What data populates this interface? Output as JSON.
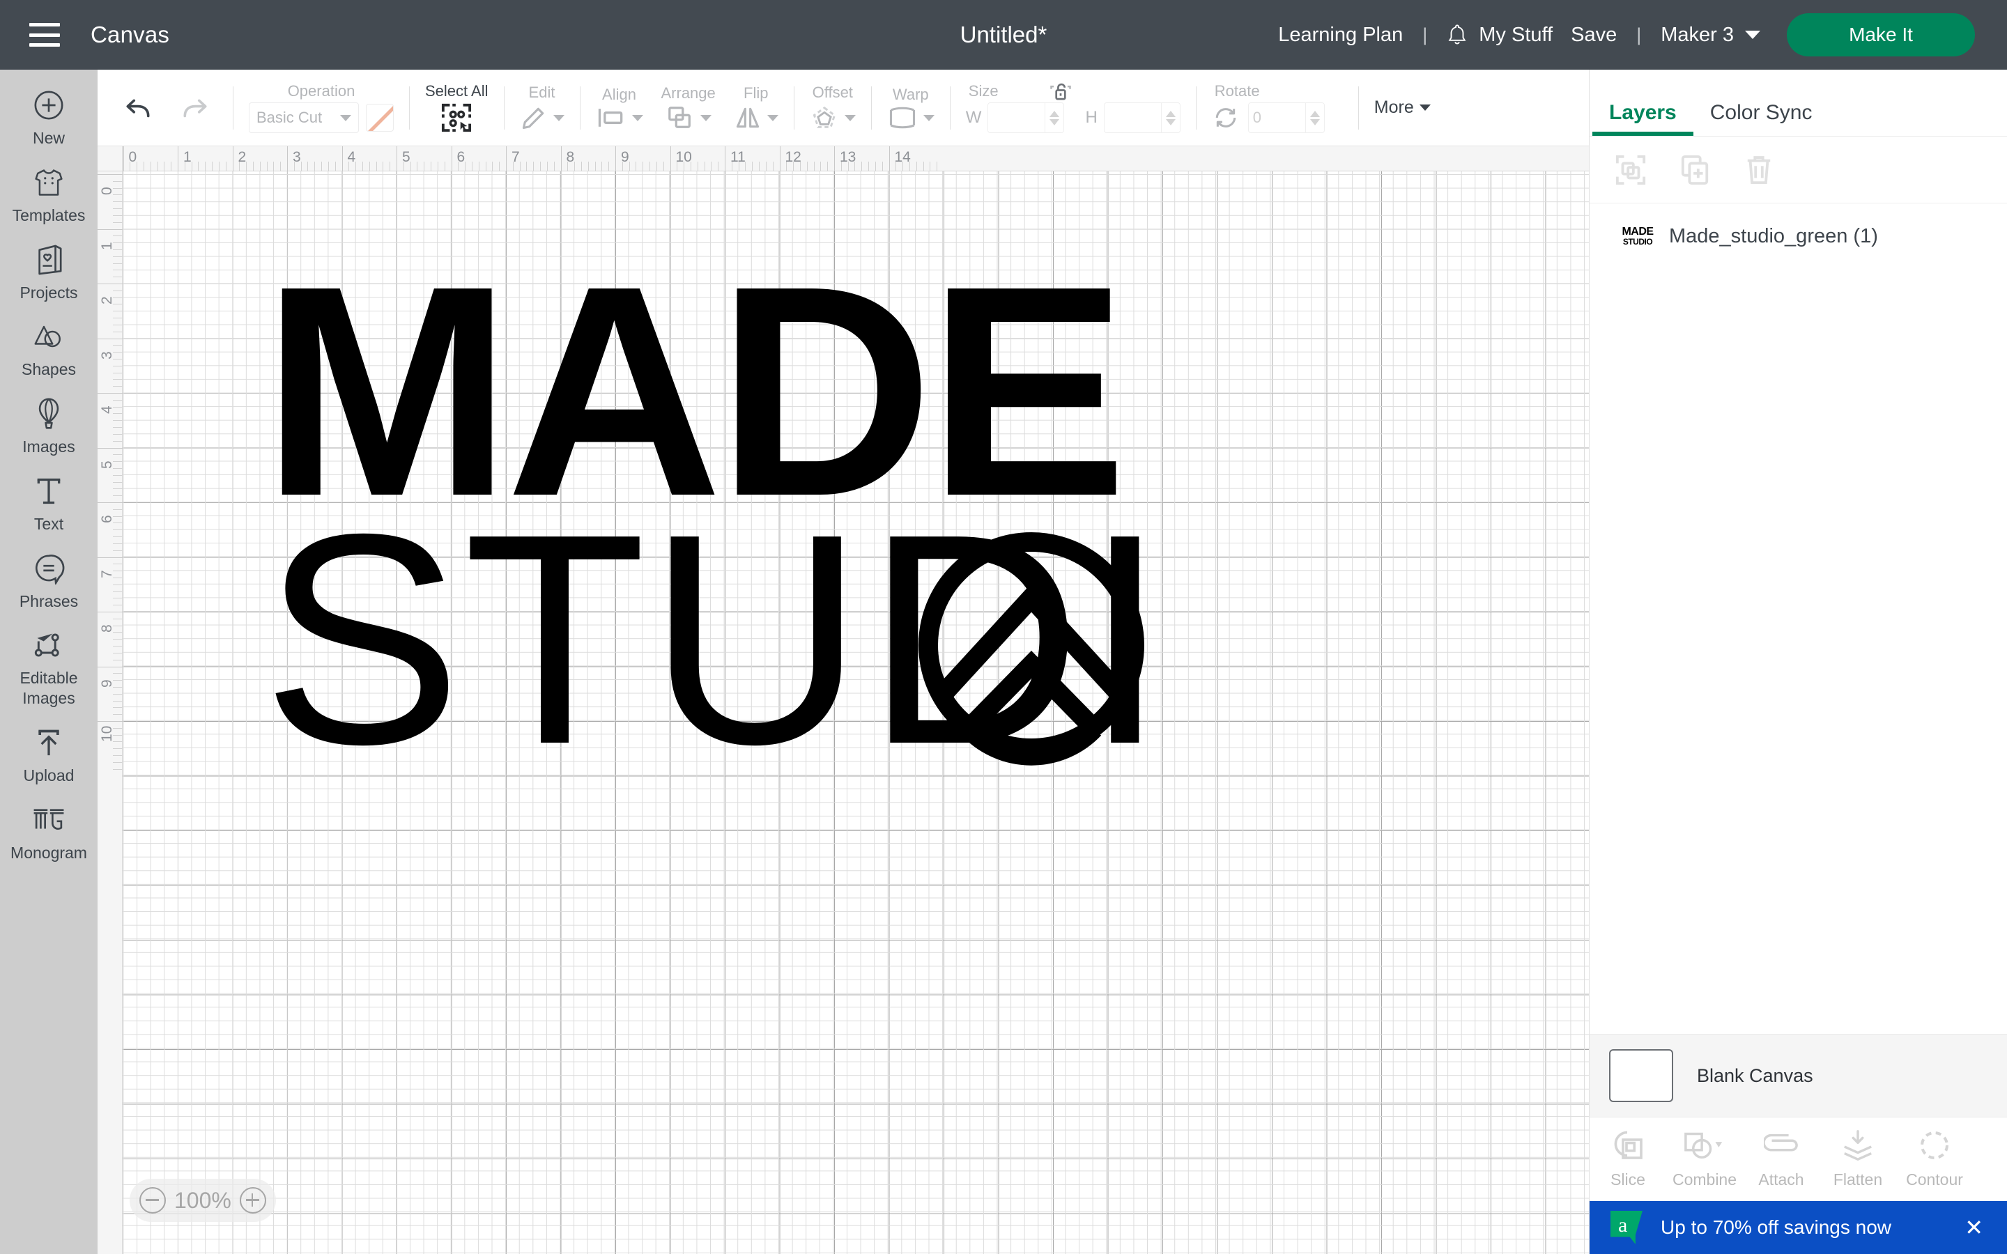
{
  "header": {
    "menu_icon": "hamburger-menu-icon",
    "canvas_label": "Canvas",
    "project_title": "Untitled*",
    "learning_plan": "Learning Plan",
    "separator": "|",
    "bell_icon": "notification-bell-icon",
    "my_stuff": "My Stuff",
    "save": "Save",
    "machine": "Maker 3",
    "make_it": "Make It",
    "accent_green": "#00855b",
    "bar_color": "#434a51"
  },
  "sidebar": {
    "items": [
      {
        "label": "New",
        "icon": "plus-circle-icon"
      },
      {
        "label": "Templates",
        "icon": "tshirt-icon"
      },
      {
        "label": "Projects",
        "icon": "card-heart-icon"
      },
      {
        "label": "Shapes",
        "icon": "shapes-icon"
      },
      {
        "label": "Images",
        "icon": "hot-air-balloon-icon"
      },
      {
        "label": "Text",
        "icon": "text-t-icon"
      },
      {
        "label": "Phrases",
        "icon": "speech-bubble-icon"
      },
      {
        "label": "Editable Images",
        "icon": "node-edit-icon"
      },
      {
        "label": "Upload",
        "icon": "upload-arrow-icon"
      },
      {
        "label": "Monogram",
        "icon": "monogram-mg-icon"
      }
    ]
  },
  "toolbar": {
    "undo": "undo-arrow-icon",
    "redo": "redo-arrow-icon",
    "operation_label": "Operation",
    "operation_value": "Basic Cut",
    "operation_swatch": "#f0b49c",
    "select_all_label": "Select All",
    "select_all_icon": "select-all-icon",
    "edit_label": "Edit",
    "align_label": "Align",
    "arrange_label": "Arrange",
    "flip_label": "Flip",
    "offset_label": "Offset",
    "warp_label": "Warp",
    "size_label": "Size",
    "size_w_label": "W",
    "size_w_value": "",
    "size_h_label": "H",
    "size_h_value": "",
    "lock_icon": "unlocked-padlock-icon",
    "rotate_label": "Rotate",
    "rotate_value": "0",
    "more_label": "More"
  },
  "canvas": {
    "zoom_level": "100%",
    "zoom_out_icon": "minus-circle-icon",
    "zoom_in_icon": "plus-circle-icon",
    "ruler_h_marks": [
      "0",
      "1",
      "2",
      "3",
      "4",
      "5",
      "6",
      "7",
      "8",
      "9",
      "10",
      "11",
      "12",
      "13",
      "14"
    ],
    "ruler_v_marks": [
      "0",
      "1",
      "2",
      "3",
      "4",
      "5",
      "6",
      "7",
      "8",
      "9",
      "10"
    ],
    "artwork": {
      "word_top": "MADE",
      "word_bottom": "STUDIO",
      "mark": "chevron-in-circle-logo",
      "color": "#000000"
    }
  },
  "right_panel": {
    "tabs": [
      {
        "label": "Layers",
        "active": true
      },
      {
        "label": "Color Sync",
        "active": false
      }
    ],
    "actions": [
      {
        "icon": "group-icon"
      },
      {
        "icon": "duplicate-icon"
      },
      {
        "icon": "delete-trash-icon"
      }
    ],
    "layers": [
      {
        "name": "Made_studio_green (1)",
        "thumb_top": "MADE",
        "thumb_bottom": "STUDIO"
      }
    ],
    "material": {
      "label": "Blank Canvas"
    },
    "operations": [
      {
        "label": "Slice",
        "icon": "slice-icon",
        "has_caret": false
      },
      {
        "label": "Combine",
        "icon": "combine-icon",
        "has_caret": true
      },
      {
        "label": "Attach",
        "icon": "attach-paperclip-icon",
        "has_caret": false
      },
      {
        "label": "Flatten",
        "icon": "flatten-icon",
        "has_caret": false
      },
      {
        "label": "Contour",
        "icon": "contour-dashed-circle-icon",
        "has_caret": false
      }
    ]
  },
  "promo": {
    "badge_letter": "a",
    "text": "Up to 70% off savings now",
    "close_icon": "close-x-icon",
    "bg_color": "#0b4fc4",
    "badge_color": "#00a76a"
  }
}
